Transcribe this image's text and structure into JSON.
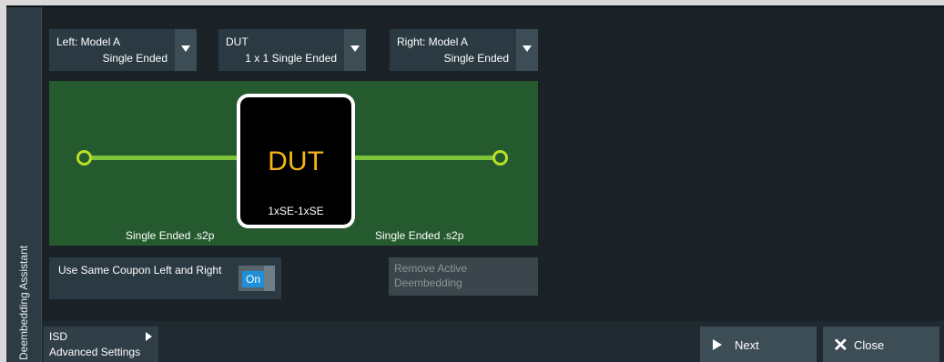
{
  "side_tab": {
    "label": "Deembedding Assistant"
  },
  "dropdowns": {
    "left": {
      "title": "Left: Model A",
      "value": "Single Ended"
    },
    "dut": {
      "title": "DUT",
      "value": "1 x 1 Single Ended"
    },
    "right": {
      "title": "Right: Model A",
      "value": "Single Ended"
    }
  },
  "diagram": {
    "dut_title": "DUT",
    "dut_subtitle": "1xSE-1xSE",
    "left_file": "Single Ended .s2p",
    "right_file": "Single Ended .s2p",
    "colors": {
      "board": "#245a2e",
      "trace": "#7dc43a",
      "port": "#b8e227",
      "dut_text": "#f3b51a"
    }
  },
  "coupon": {
    "label": "Use Same Coupon Left and Right",
    "toggle_value": "On"
  },
  "remove_button": {
    "label": "Remove Active Deembedding"
  },
  "bottom": {
    "isd_line1": "ISD",
    "isd_line2": "Advanced Settings",
    "next_label": "Next",
    "close_label": "Close"
  }
}
